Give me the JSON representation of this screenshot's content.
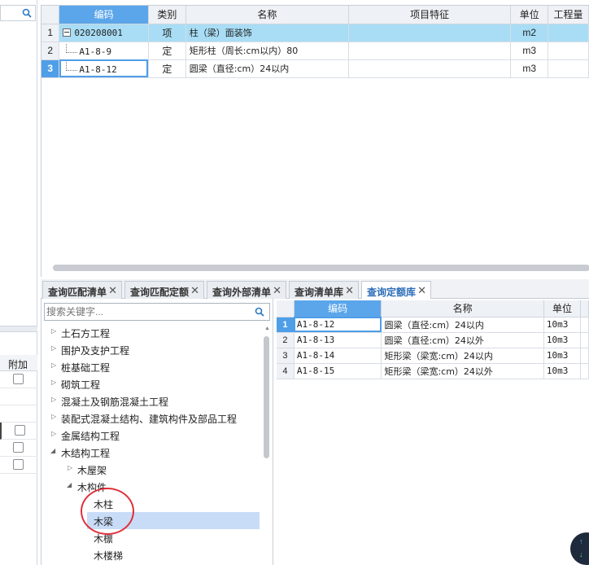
{
  "top_grid": {
    "headers": {
      "code": "编码",
      "type": "类别",
      "name": "名称",
      "feature": "项目特征",
      "unit": "单位",
      "qty": "工程量"
    },
    "rows": [
      {
        "num": "1",
        "code": "020208001",
        "type": "项",
        "name": "柱（梁）面装饰",
        "feature": "",
        "unit": "m2"
      },
      {
        "num": "2",
        "code": "A1-8-9",
        "type": "定",
        "name": "矩形柱（周长:cm以内）80",
        "feature": "",
        "unit": "m3"
      },
      {
        "num": "3",
        "code": "A1-8-12",
        "type": "定",
        "name": "圆梁（直径:cm）24以内",
        "feature": "",
        "unit": "m3"
      }
    ]
  },
  "tabs": [
    {
      "label": "查询匹配清单",
      "close": "✕"
    },
    {
      "label": "查询匹配定额",
      "close": "✕"
    },
    {
      "label": "查询外部清单",
      "close": "✕"
    },
    {
      "label": "查询清单库",
      "close": "✕"
    },
    {
      "label": "查询定额库",
      "close": "✕"
    }
  ],
  "tree": {
    "search_placeholder": "搜索关键字...",
    "nodes": [
      "土石方工程",
      "围护及支护工程",
      "桩基础工程",
      "砌筑工程",
      "混凝土及钢筋混凝土工程",
      "装配式混凝土结构、建筑构件及部品工程",
      "金属结构工程",
      "木结构工程",
      "木屋架",
      "木构件",
      "木柱",
      "木梁",
      "木檩",
      "木楼梯"
    ]
  },
  "lib_grid": {
    "headers": {
      "code": "编码",
      "name": "名称",
      "unit": "单位"
    },
    "rows": [
      {
        "num": "1",
        "code": "A1-8-12",
        "name": "圆梁（直径:cm）24以内",
        "unit": "10m3"
      },
      {
        "num": "2",
        "code": "A1-8-13",
        "name": "圆梁（直径:cm）24以外",
        "unit": "10m3"
      },
      {
        "num": "3",
        "code": "A1-8-14",
        "name": "矩形梁（梁宽:cm）24以内",
        "unit": "10m3"
      },
      {
        "num": "4",
        "code": "A1-8-15",
        "name": "矩形梁（梁宽:cm）24以外",
        "unit": "10m3"
      }
    ]
  },
  "left": {
    "add_header": "附加"
  },
  "float_button": {
    "up": "↑",
    "down": "↓"
  },
  "colors": {
    "accent": "#5ba6ea",
    "highlight_row": "#a8ddf5",
    "annotation": "#e0303a"
  }
}
